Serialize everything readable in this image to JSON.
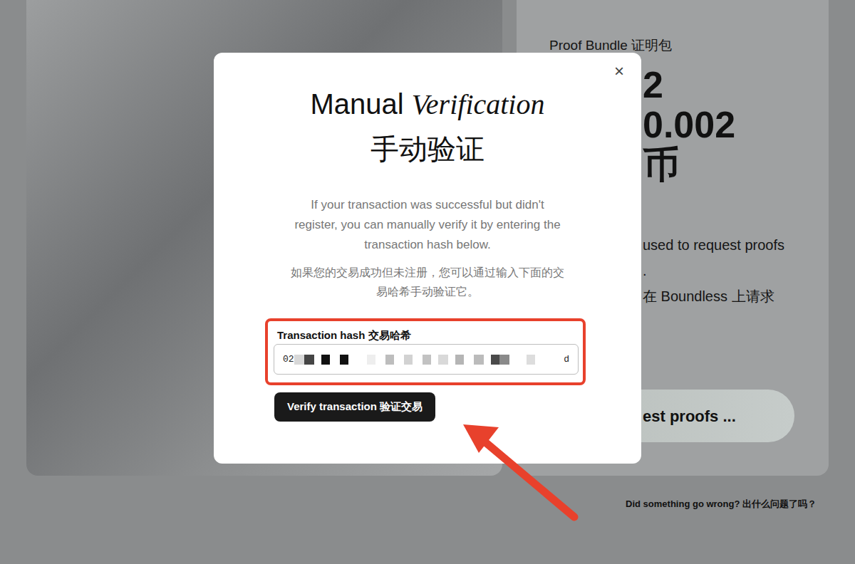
{
  "proof_card": {
    "title": "Proof Bundle  证明包",
    "amount_lines": [
      "2",
      "0.002",
      "币"
    ],
    "description_lines": [
      "used to request proofs",
      ".",
      "在 Boundless 上请求"
    ],
    "button": "est proofs ..."
  },
  "help_link": "Did something go wrong?  出什么问题了吗？",
  "dialog": {
    "close": "×",
    "title_plain": "Manual",
    "title_italic": "Verification",
    "title_zh": "手动验证",
    "description_lines": [
      "If your transaction was successful but didn't",
      "register, you can manually verify it by entering the",
      "transaction hash below."
    ],
    "description_zh_lines": [
      "如果您的交易成功但未注册，您可以通过输入下面的交",
      "易哈希手动验证它。"
    ],
    "field": {
      "label": "Transaction hash  交易哈希",
      "value_start": "02",
      "value_end": "d",
      "redacted": true,
      "highlighted": true
    },
    "button": "Verify transaction  验证交易"
  },
  "annotation": {
    "arrow": true,
    "color": "#e8412c"
  }
}
